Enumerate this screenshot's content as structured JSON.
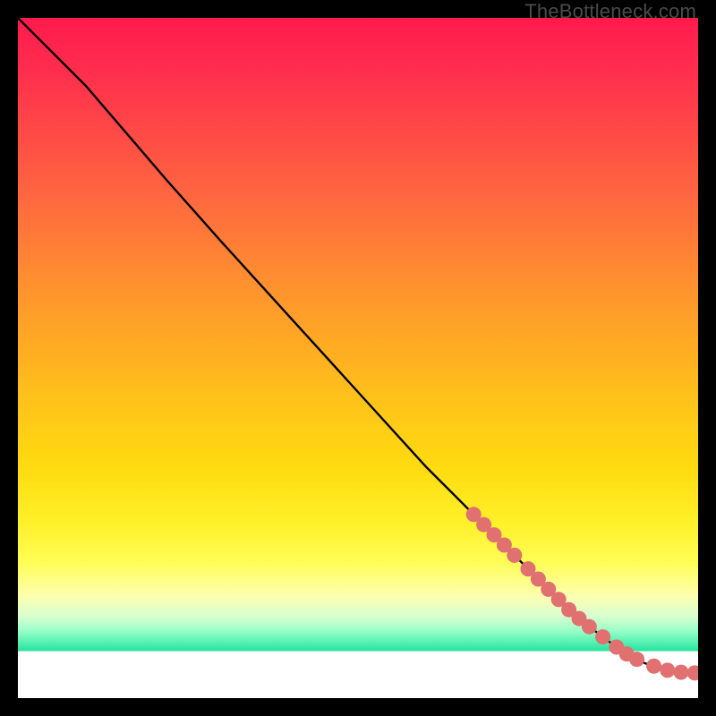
{
  "watermark": "TheBottleneck.com",
  "colors": {
    "curve_stroke": "#000000",
    "marker_fill": "#e17070",
    "marker_stroke": "#c95a5a"
  },
  "chart_data": {
    "type": "line",
    "title": "",
    "xlabel": "",
    "ylabel": "",
    "xlim": [
      0,
      100
    ],
    "ylim": [
      0,
      100
    ],
    "grid": false,
    "legend": false,
    "series": [
      {
        "name": "curve",
        "x": [
          0,
          3,
          6,
          10,
          16,
          22,
          30,
          40,
          50,
          60,
          67,
          72,
          76,
          80,
          84,
          88,
          92,
          95,
          97,
          99,
          100
        ],
        "y": [
          100,
          97,
          94,
          90,
          83,
          76,
          67,
          56,
          45,
          34,
          27,
          22,
          18,
          14,
          10.5,
          7.5,
          5.2,
          4.1,
          3.8,
          3.7,
          3.7
        ]
      }
    ],
    "markers": [
      {
        "x": 67.0,
        "y": 27.0
      },
      {
        "x": 68.5,
        "y": 25.5
      },
      {
        "x": 70.0,
        "y": 24.0
      },
      {
        "x": 71.5,
        "y": 22.5
      },
      {
        "x": 73.0,
        "y": 21.0
      },
      {
        "x": 75.0,
        "y": 19.0
      },
      {
        "x": 76.5,
        "y": 17.5
      },
      {
        "x": 78.0,
        "y": 16.0
      },
      {
        "x": 79.5,
        "y": 14.5
      },
      {
        "x": 81.0,
        "y": 13.0
      },
      {
        "x": 82.5,
        "y": 11.7
      },
      {
        "x": 84.0,
        "y": 10.5
      },
      {
        "x": 86.0,
        "y": 9.0
      },
      {
        "x": 88.0,
        "y": 7.5
      },
      {
        "x": 89.5,
        "y": 6.5
      },
      {
        "x": 91.0,
        "y": 5.7
      },
      {
        "x": 93.5,
        "y": 4.7
      },
      {
        "x": 95.5,
        "y": 4.1
      },
      {
        "x": 97.5,
        "y": 3.8
      },
      {
        "x": 99.5,
        "y": 3.7
      }
    ]
  }
}
